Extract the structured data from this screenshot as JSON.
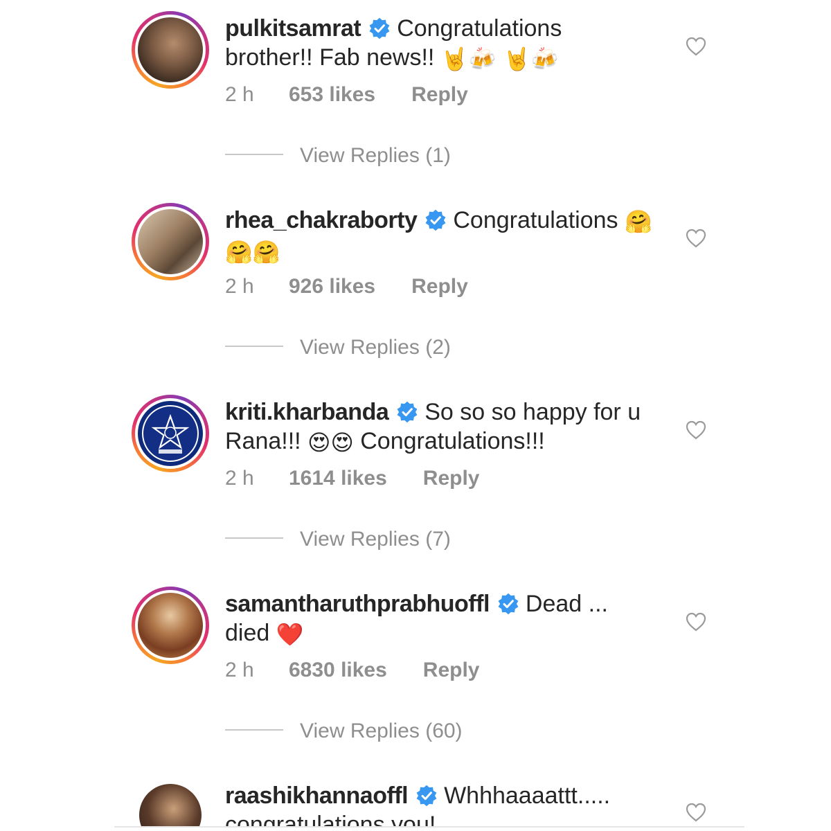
{
  "comments": [
    {
      "username": "pulkitsamrat",
      "text_line1": "Congratulations",
      "text_line2": "brother!! Fab news!!",
      "emojis": "🤘🍻 🤘🍻",
      "time": "2 h",
      "likes": "653 likes",
      "reply_label": "Reply",
      "view_replies": "View Replies (1)"
    },
    {
      "username": "rhea_chakraborty",
      "text_line1": "Congratulations",
      "emoji_inline": "🤗",
      "emojis_line2": "🤗🤗",
      "time": "2 h",
      "likes": "926 likes",
      "reply_label": "Reply",
      "view_replies": "View Replies (2)"
    },
    {
      "username": "kriti.kharbanda",
      "text_line1": "So so so happy for u",
      "text_line2_a": "Rana!!!",
      "emojis": "😍😍",
      "text_line2_b": "Congratulations!!!",
      "time": "2 h",
      "likes": "1614 likes",
      "reply_label": "Reply",
      "view_replies": "View Replies (7)"
    },
    {
      "username": "samantharuthprabhuoffl",
      "text_line1": "Dead ...",
      "text_line2": "died",
      "emojis": "❤️",
      "time": "2 h",
      "likes": "6830 likes",
      "reply_label": "Reply",
      "view_replies": "View Replies (60)"
    },
    {
      "username": "raashikhannaoffl",
      "text_line1": "Whhhaaaattt.....",
      "text_line2": "congratulations you!"
    }
  ],
  "colors": {
    "verified_blue": "#3897f0",
    "meta_gray": "#8e8e8e",
    "text_dark": "#262626"
  }
}
